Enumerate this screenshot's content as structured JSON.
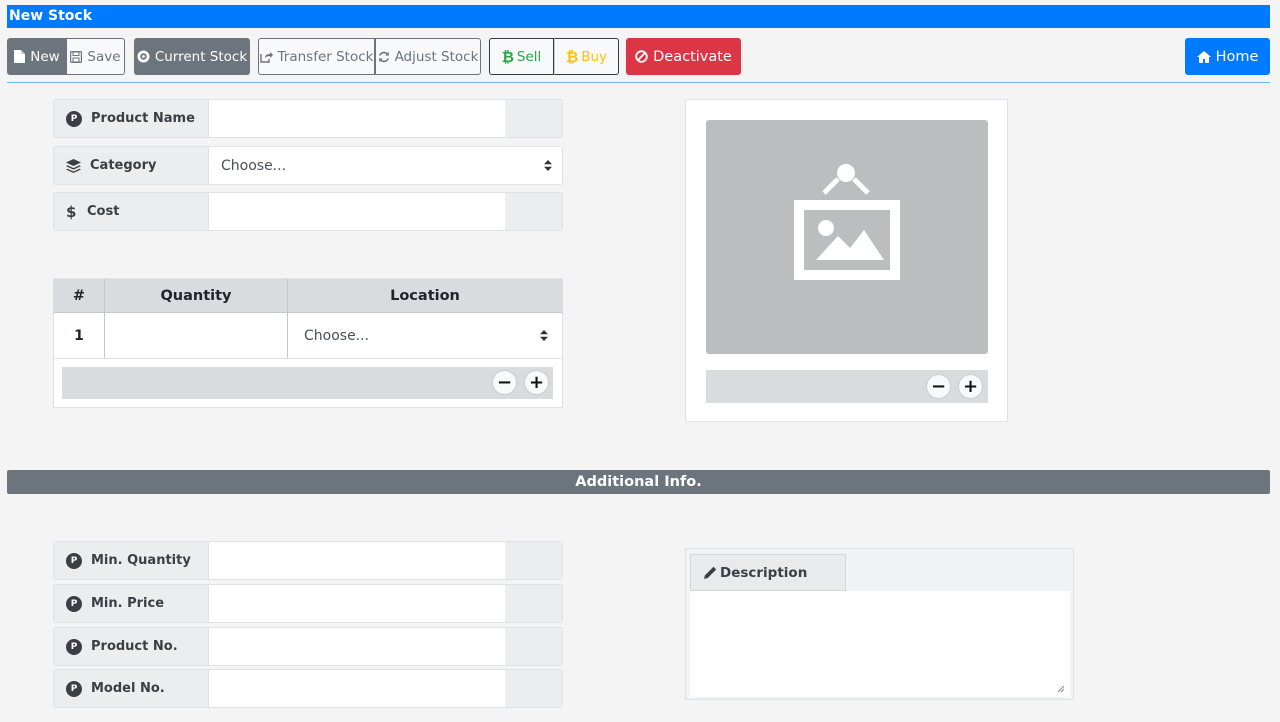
{
  "window": {
    "title": "New Stock"
  },
  "toolbar": {
    "new_label": "New",
    "save_label": "Save",
    "current_stock_label": "Current Stock",
    "transfer_stock_label": "Transfer Stock",
    "adjust_stock_label": "Adjust Stock",
    "sell_label": "Sell",
    "buy_label": "Buy",
    "deactivate_label": "Deactivate",
    "home_label": "Home"
  },
  "form": {
    "product_name": {
      "label": "Product Name",
      "value": ""
    },
    "category": {
      "label": "Category",
      "selected": "Choose..."
    },
    "cost": {
      "label": "Cost",
      "value": ""
    }
  },
  "stock_table": {
    "columns": [
      "#",
      "Quantity",
      "Location"
    ],
    "rows": [
      {
        "index": "1",
        "quantity": "",
        "location": "Choose..."
      }
    ],
    "remove_symbol": "−",
    "add_symbol": "+"
  },
  "image_panel": {
    "remove_symbol": "−",
    "add_symbol": "+"
  },
  "additional": {
    "section_title": "Additional Info.",
    "min_quantity": {
      "label": "Min. Quantity",
      "value": ""
    },
    "min_price": {
      "label": "Min. Price",
      "value": ""
    },
    "product_no": {
      "label": "Product No.",
      "value": ""
    },
    "model_no": {
      "label": "Model No.",
      "value": ""
    },
    "description": {
      "label": "Description",
      "value": ""
    }
  },
  "colors": {
    "primary": "#007bff",
    "secondary": "#6c757d",
    "danger": "#dc3545",
    "success": "#28a745",
    "warning": "#ffc107"
  },
  "icons": {
    "new": "file-icon",
    "save": "floppy-icon",
    "current_stock": "circle-cog-icon",
    "transfer": "share-square-icon",
    "adjust": "refresh-icon",
    "sell": "bitcoin-icon",
    "buy": "bitcoin-icon",
    "deactivate": "ban-icon",
    "home": "home-icon",
    "product": "p-circle-icon",
    "category": "layers-icon",
    "cost": "dollar-icon",
    "description": "pencil-icon"
  }
}
